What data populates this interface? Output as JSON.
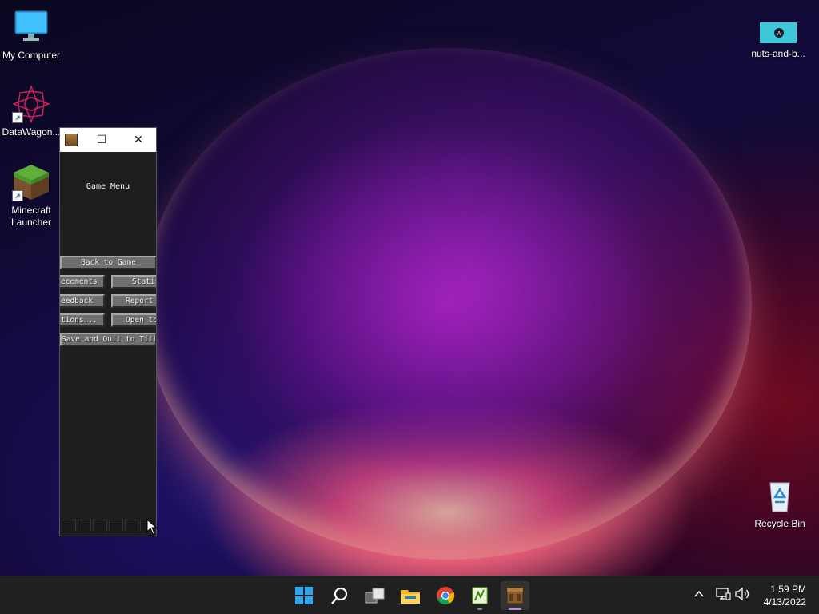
{
  "desktop": {
    "icons": [
      {
        "label": "My Computer",
        "icon": "monitor-icon"
      },
      {
        "label": "DataWagon...",
        "icon": "datawagon-icon"
      },
      {
        "label": "Minecraft Launcher",
        "icon": "minecraft-grass-block-icon"
      },
      {
        "label": "nuts-and-b...",
        "icon": "image-file-icon"
      },
      {
        "label": "Recycle Bin",
        "icon": "recycle-bin-icon"
      }
    ]
  },
  "window": {
    "title_icon": "minecraft-crafting-table-icon",
    "maximize_glyph": "☐",
    "close_glyph": "✕",
    "game_menu": {
      "title": "Game Menu",
      "back_to_game": "Back to Game",
      "advancements": "ecements",
      "statistics": "Statist",
      "give_feedback": "eedback",
      "report_bugs": "Report",
      "options": "tions...",
      "open_to_lan": "Open to",
      "save_and_quit": "Save and Quit to Title"
    }
  },
  "taskbar": {
    "apps": [
      "windows-start-icon",
      "search-icon",
      "task-view-icon",
      "file-explorer-icon",
      "chrome-icon",
      "notepad-plus-icon",
      "minecraft-icon"
    ],
    "tray": {
      "chevron": "^",
      "clock_time": "1:59 PM",
      "clock_date": "4/13/2022"
    }
  },
  "colors": {
    "taskbar_bg": "#202020",
    "window_bg": "#1e1e1e",
    "mc_button": "#6f6f6f",
    "accent_indicator": "#c08bd8"
  }
}
